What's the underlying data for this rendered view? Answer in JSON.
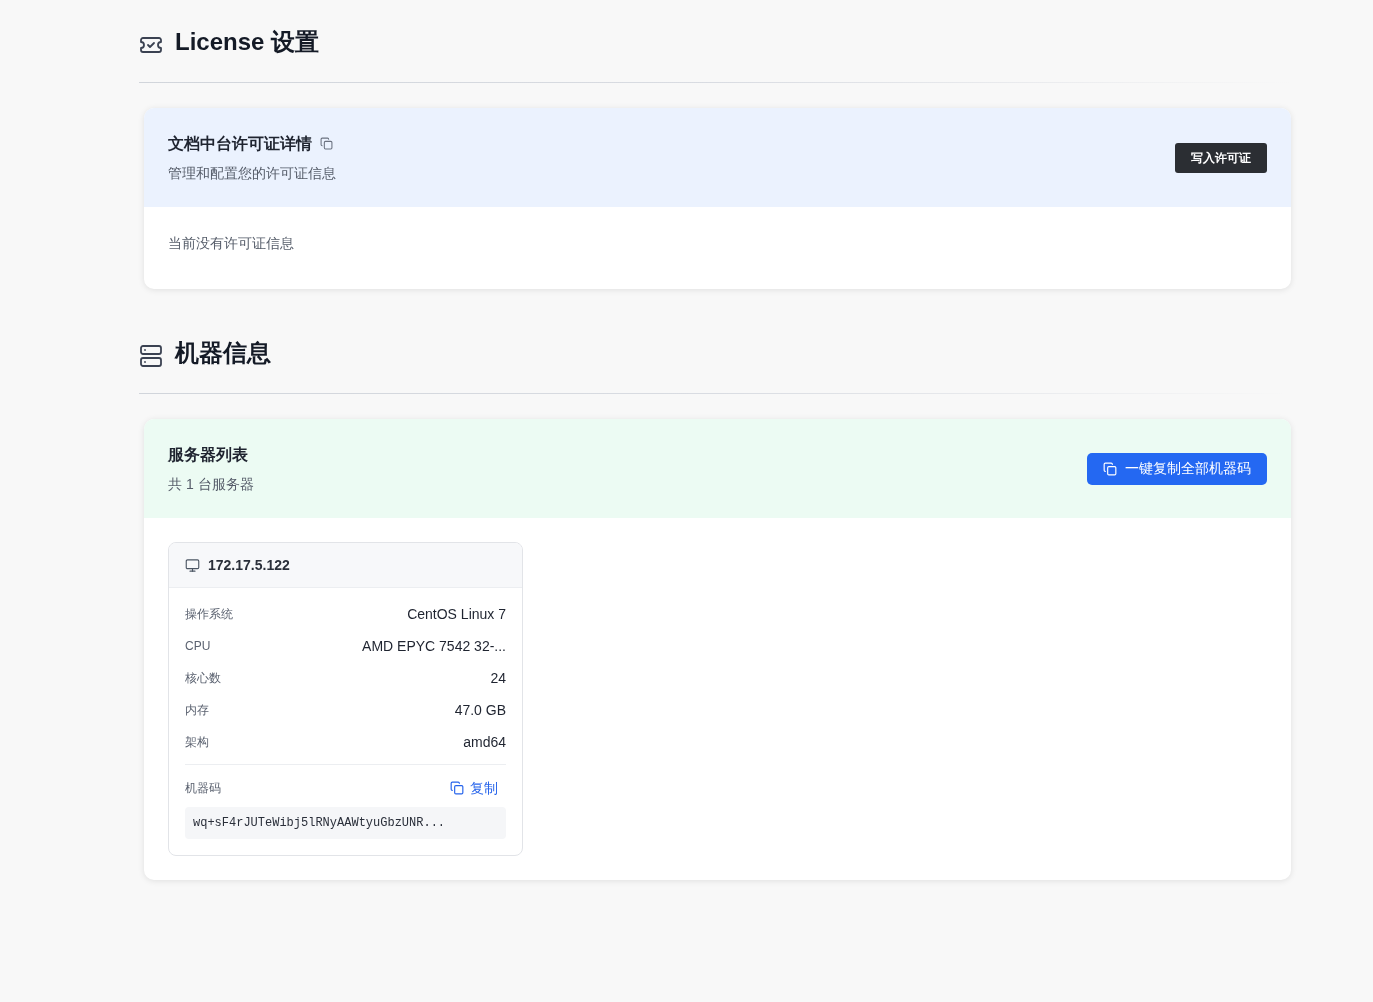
{
  "license_section": {
    "title": "License 设置",
    "card": {
      "title": "文档中台许可证详情",
      "subtitle": "管理和配置您的许可证信息",
      "button": "写入许可证",
      "empty_text": "当前没有许可证信息"
    }
  },
  "machine_section": {
    "title": "机器信息",
    "card": {
      "title": "服务器列表",
      "subtitle": "共 1 台服务器",
      "button": "一键复制全部机器码",
      "servers": [
        {
          "ip": "172.17.5.122",
          "fields": [
            {
              "label": "操作系统",
              "value": "CentOS Linux 7"
            },
            {
              "label": "CPU",
              "value": "AMD EPYC 7542 32-..."
            },
            {
              "label": "核心数",
              "value": "24"
            },
            {
              "label": "内存",
              "value": "47.0 GB"
            },
            {
              "label": "架构",
              "value": "amd64"
            }
          ],
          "machine_code": {
            "label": "机器码",
            "copy": "复制",
            "value": "wq+sF4rJUTeWibj5lRNyAAWtyuGbzUNR..."
          }
        }
      ]
    }
  }
}
